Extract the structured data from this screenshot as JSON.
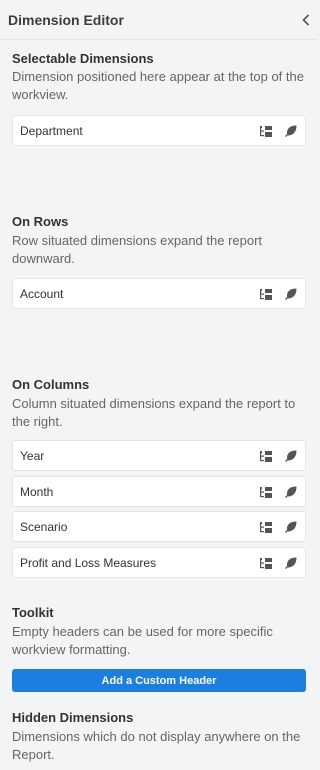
{
  "panel": {
    "title": "Dimension Editor",
    "collapse_icon": "chevron-left-icon"
  },
  "sections": {
    "selectable": {
      "title": "Selectable Dimensions",
      "desc": "Dimension positioned here appear at the top of the workview.",
      "items": [
        {
          "label": "Department"
        }
      ]
    },
    "rows": {
      "title": "On Rows",
      "desc": "Row situated dimensions expand the report downward.",
      "items": [
        {
          "label": "Account"
        }
      ]
    },
    "columns": {
      "title": "On Columns",
      "desc": "Column situated dimensions expand the report to the right.",
      "items": [
        {
          "label": "Year"
        },
        {
          "label": "Month"
        },
        {
          "label": "Scenario"
        },
        {
          "label": "Profit and Loss Measures"
        }
      ]
    },
    "toolkit": {
      "title": "Toolkit",
      "desc": "Empty headers can be used for more specific workview formatting.",
      "button_label": "Add a Custom Header"
    },
    "hidden": {
      "title": "Hidden Dimensions",
      "desc": "Dimensions which do not display anywhere on the Report."
    }
  },
  "icons": {
    "hierarchy": "hierarchy-icon",
    "leaf": "leaf-icon"
  },
  "colors": {
    "accent": "#1a7fe0",
    "background": "#f3f4f6"
  }
}
